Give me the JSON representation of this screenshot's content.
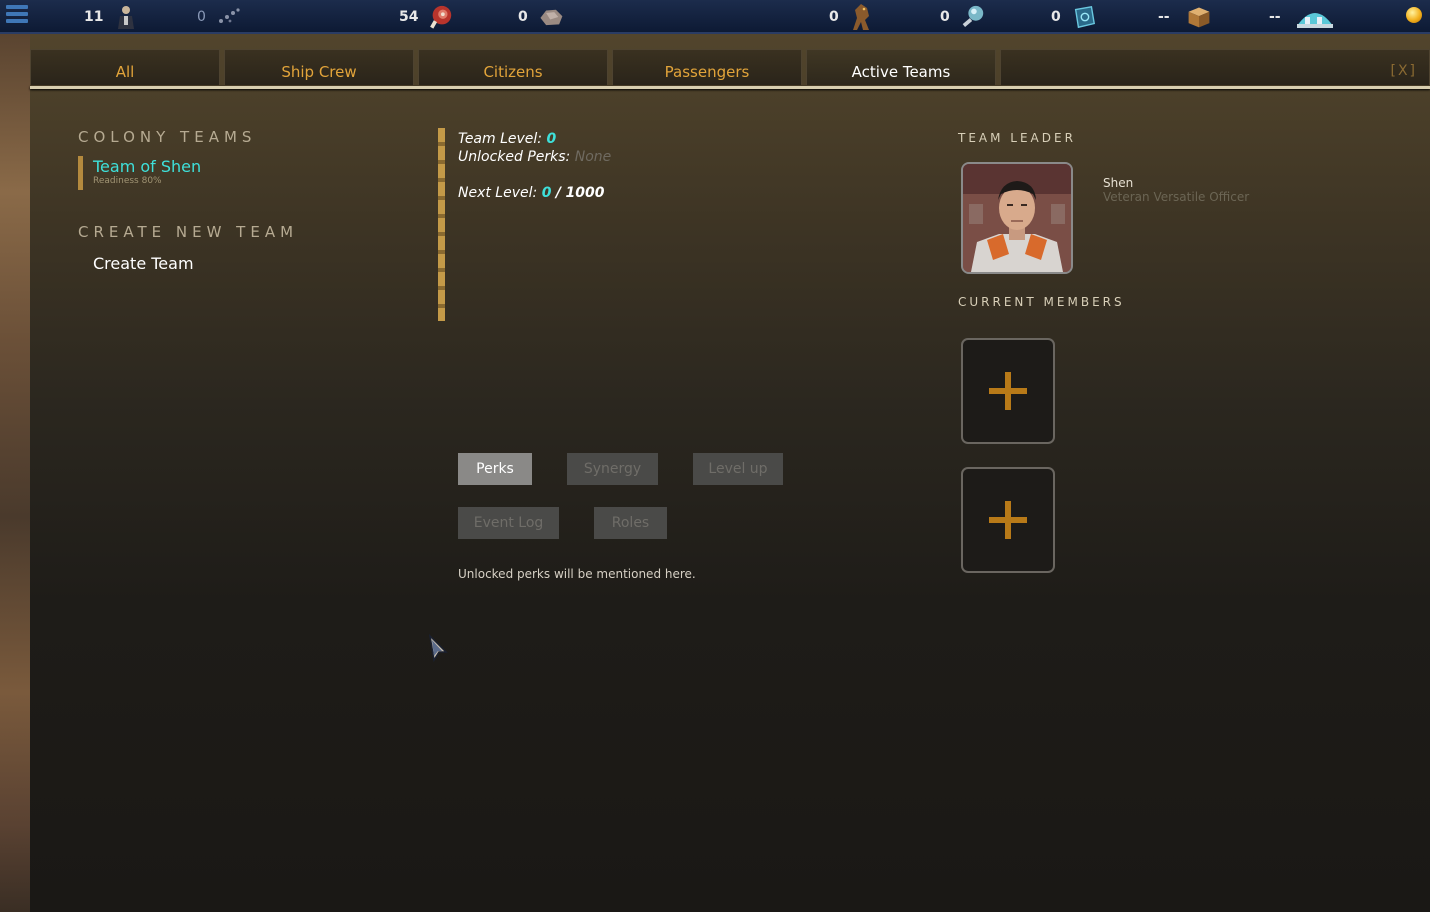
{
  "topbar": {
    "resources": [
      {
        "value": "11",
        "icon": "officer-icon",
        "dim": false
      },
      {
        "value": "0",
        "icon": "fragments-icon",
        "dim": true
      },
      {
        "value": "54",
        "icon": "meat-icon",
        "dim": false
      },
      {
        "value": "0",
        "icon": "ore-icon",
        "dim": false
      },
      {
        "value": "0",
        "icon": "creature-icon",
        "dim": false
      },
      {
        "value": "0",
        "icon": "crystal-icon",
        "dim": false
      },
      {
        "value": "0",
        "icon": "blueprint-icon",
        "dim": false
      },
      {
        "value": "--",
        "icon": "crate-icon",
        "dim": false
      },
      {
        "value": "--",
        "icon": "habitat-icon",
        "dim": false
      }
    ]
  },
  "tabs": [
    "All",
    "Ship Crew",
    "Citizens",
    "Passengers",
    "Active Teams"
  ],
  "active_tab": "Active Teams",
  "close_label": "[X]",
  "left": {
    "colony_teams_title": "COLONY TEAMS",
    "team_name": "Team of Shen",
    "team_readiness": "Readiness 80%",
    "create_title": "CREATE NEW TEAM",
    "create_button": "Create Team"
  },
  "middle": {
    "team_level_label": "Team Level:",
    "team_level_value": "0",
    "unlocked_perks_label": "Unlocked Perks:",
    "unlocked_perks_value": "None",
    "next_level_label": "Next Level:",
    "next_level_current": "0",
    "next_level_sep": "/",
    "next_level_target": "1000",
    "buttons": {
      "perks": "Perks",
      "synergy": "Synergy",
      "level_up": "Level up",
      "event_log": "Event Log",
      "roles": "Roles"
    },
    "perk_note": "Unlocked perks will be mentioned here."
  },
  "right": {
    "leader_title": "TEAM LEADER",
    "leader_name": "Shen",
    "leader_role": "Veteran Versatile Officer",
    "members_title": "CURRENT MEMBERS",
    "slot_symbol": "+"
  },
  "colors": {
    "accent_cyan": "#3ee0da",
    "tab_text": "#e2a43a",
    "plus_color": "#b87a18"
  }
}
